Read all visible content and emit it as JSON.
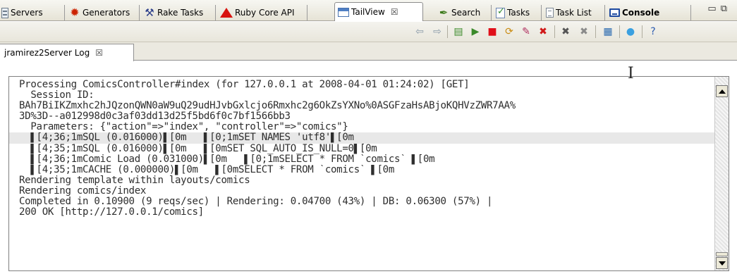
{
  "tabs": [
    {
      "label": "Servers",
      "icon": "servers-icon"
    },
    {
      "label": "Generators",
      "icon": "generators-icon"
    },
    {
      "label": "Rake Tasks",
      "icon": "rake-tasks-icon"
    },
    {
      "label": "Ruby Core API",
      "icon": "ruby-icon"
    },
    {
      "label": "TailView",
      "icon": "tailview-icon",
      "active": true,
      "close": "☒"
    },
    {
      "label": "Search",
      "icon": "search-icon"
    },
    {
      "label": "Tasks",
      "icon": "tasks-icon"
    },
    {
      "label": "Task List",
      "icon": "task-list-icon"
    },
    {
      "label": "Console",
      "icon": "console-icon",
      "bold": true
    }
  ],
  "window_controls": {
    "minimize": "▭",
    "restore": "⧉"
  },
  "toolbar": [
    {
      "name": "back-icon",
      "glyph": "⇦",
      "color": "#8a9aa8"
    },
    {
      "name": "forward-icon",
      "glyph": "⇨",
      "color": "#8a9aa8"
    },
    {
      "name": "open-file-icon",
      "glyph": "▤",
      "color": "#3a8a2a"
    },
    {
      "name": "play-icon",
      "glyph": "▶",
      "color": "#3a8a2a"
    },
    {
      "name": "stop-icon",
      "glyph": "■",
      "color": "#e0101a"
    },
    {
      "name": "refresh-icon",
      "glyph": "⟳",
      "color": "#c98a10"
    },
    {
      "name": "clear-icon",
      "glyph": "✎",
      "color": "#b03060"
    },
    {
      "name": "remove-icon",
      "glyph": "✖",
      "color": "#d01818"
    },
    {
      "name": "remove-all-icon",
      "glyph": "✖",
      "color": "#555555"
    },
    {
      "name": "remove-all-terminated-icon",
      "glyph": "✖",
      "color": "#8a8a8a"
    },
    {
      "name": "pin-console-icon",
      "glyph": "▦",
      "color": "#2a6ab0"
    },
    {
      "name": "color-icon",
      "glyph": "●",
      "color": "#3aa0e0"
    },
    {
      "name": "help-icon",
      "glyph": "?",
      "color": "#2a5ab0"
    }
  ],
  "log_view": {
    "tab_label": "jramirez2Server Log",
    "close": "☒",
    "lines": [
      "Processing ComicsController#index (for 127.0.0.1 at 2008-04-01 01:24:02) [GET]",
      "  Session ID:",
      "BAh7BiIKZmxhc2hJQzonQWN0aW9uQ29udHJvbGxlcjo6Rmxhc2g6OkZsYXNo%0ASGFzaHsABjoKQHVzZWR7AA%",
      "3D%3D--a012998d0c3af03dd13d25f5bd6f0c7bf1566bb3",
      "  Parameters: {\"action\"=>\"index\", \"controller\"=>\"comics\"}",
      "  ▌[4;36;1mSQL (0.016000)▌[0m   ▌[0;1mSET NAMES 'utf8'▌[0m",
      "  ▌[4;35;1mSQL (0.016000)▌[0m   ▌[0mSET SQL_AUTO_IS_NULL=0▌[0m",
      "  ▌[4;36;1mComic Load (0.031000)▌[0m   ▌[0;1mSELECT * FROM `comics` ▌[0m",
      "  ▌[4;35;1mCACHE (0.000000)▌[0m   ▌[0mSELECT * FROM `comics` ▌[0m",
      "Rendering template within layouts/comics",
      "Rendering comics/index",
      "Completed in 0.10900 (9 reqs/sec) | Rendering: 0.04700 (43%) | DB: 0.06300 (57%) |",
      "200 OK [http://127.0.0.1/comics]"
    ],
    "highlighted_line": 5
  }
}
